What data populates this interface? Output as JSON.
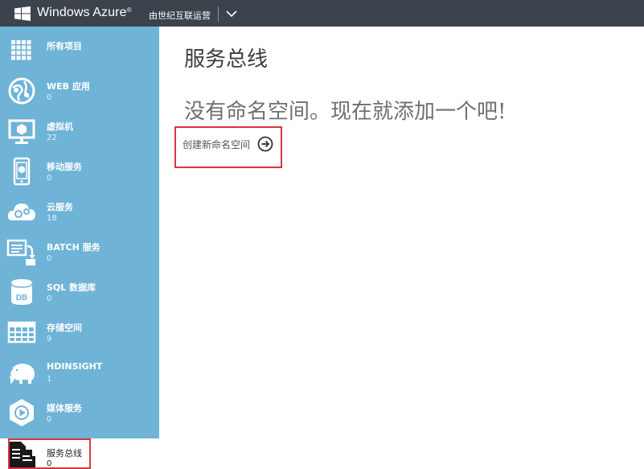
{
  "header": {
    "brand": "Windows Azure",
    "brand_mark": "®",
    "operator": "由世纪互联运营"
  },
  "sidebar": {
    "items": [
      {
        "label": "所有项目",
        "count": ""
      },
      {
        "label": "WEB 应用",
        "count": "0"
      },
      {
        "label": "虚拟机",
        "count": "22"
      },
      {
        "label": "移动服务",
        "count": "0"
      },
      {
        "label": "云服务",
        "count": "18"
      },
      {
        "label": "BATCH 服务",
        "count": "0"
      },
      {
        "label": "SQL 数据库",
        "count": "0"
      },
      {
        "label": "存储空间",
        "count": "9"
      },
      {
        "label": "HDINSIGHT",
        "count": "1"
      },
      {
        "label": "媒体服务",
        "count": "0"
      },
      {
        "label": "服务总线",
        "count": "0"
      }
    ],
    "active_index": 10
  },
  "main": {
    "title": "服务总线",
    "empty_message": "没有命名空间。现在就添加一个吧!",
    "create_link": "创建新命名空间"
  },
  "colors": {
    "topbar": "#3c434d",
    "sidebar": "#6fb3d7",
    "highlight": "#d9363e"
  }
}
